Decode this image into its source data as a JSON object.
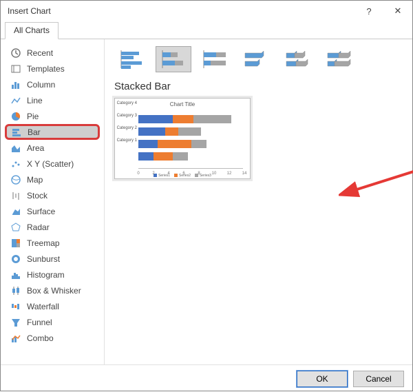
{
  "dialog": {
    "title": "Insert Chart",
    "help_glyph": "?",
    "close_glyph": "✕"
  },
  "tab": {
    "label": "All Charts"
  },
  "sidebar": {
    "items": [
      {
        "label": "Recent"
      },
      {
        "label": "Templates"
      },
      {
        "label": "Column"
      },
      {
        "label": "Line"
      },
      {
        "label": "Pie"
      },
      {
        "label": "Bar"
      },
      {
        "label": "Area"
      },
      {
        "label": "X Y (Scatter)"
      },
      {
        "label": "Map"
      },
      {
        "label": "Stock"
      },
      {
        "label": "Surface"
      },
      {
        "label": "Radar"
      },
      {
        "label": "Treemap"
      },
      {
        "label": "Sunburst"
      },
      {
        "label": "Histogram"
      },
      {
        "label": "Box & Whisker"
      },
      {
        "label": "Waterfall"
      },
      {
        "label": "Funnel"
      },
      {
        "label": "Combo"
      }
    ],
    "selected_index": 5
  },
  "main": {
    "section_title": "Stacked Bar",
    "preview_title": "Chart Title",
    "legend": {
      "s1": "Series1",
      "s2": "Series2",
      "s3": "Series3"
    }
  },
  "chart_data": {
    "type": "bar",
    "orientation": "horizontal",
    "stacked": true,
    "title": "Chart Title",
    "categories": [
      "Category 4",
      "Category 3",
      "Category 2",
      "Category 1"
    ],
    "x_ticks": [
      0,
      2,
      4,
      6,
      8,
      10,
      12,
      14
    ],
    "xlim": [
      0,
      14
    ],
    "series": [
      {
        "name": "Series1",
        "color": "#4472c4",
        "values": [
          4.5,
          3.5,
          2.5,
          2.0
        ]
      },
      {
        "name": "Series2",
        "color": "#ed7d31",
        "values": [
          2.8,
          1.8,
          4.5,
          2.5
        ]
      },
      {
        "name": "Series3",
        "color": "#a5a5a5",
        "values": [
          5.0,
          3.0,
          2.0,
          2.0
        ]
      }
    ]
  },
  "footer": {
    "ok": "OK",
    "cancel": "Cancel"
  }
}
